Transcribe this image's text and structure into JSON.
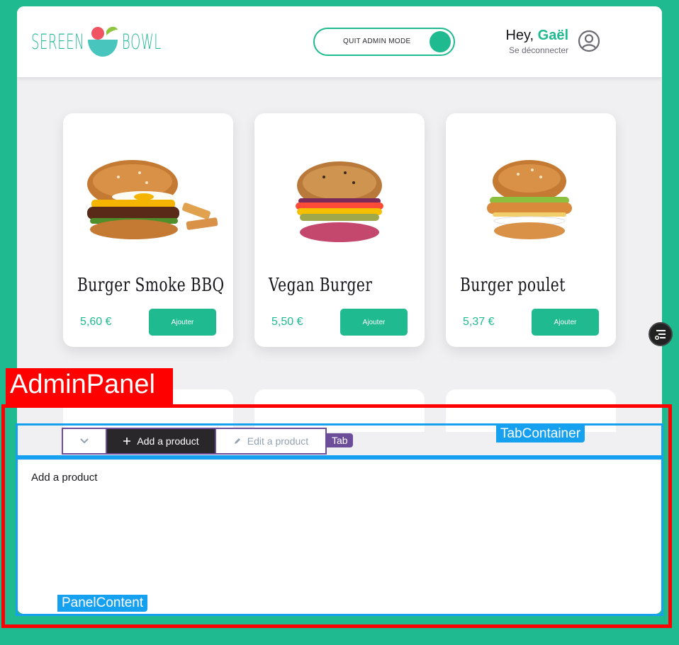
{
  "brand": {
    "logo_left": "SEREEN",
    "logo_right": "BOWL"
  },
  "header": {
    "toggle_label": "QUIT ADMIN MODE",
    "greeting_prefix": "Hey, ",
    "user_name": "Gaël",
    "logout_label": "Se déconnecter"
  },
  "products": [
    {
      "title": "Burger Smoke BBQ",
      "price": "5,60 €",
      "button": "Ajouter",
      "image_icon": "burger-bbq-image"
    },
    {
      "title": "Vegan Burger",
      "price": "5,50 €",
      "button": "Ajouter",
      "image_icon": "vegan-burger-image"
    },
    {
      "title": "Burger poulet",
      "price": "5,37 €",
      "button": "Ajouter",
      "image_icon": "chicken-burger-image"
    }
  ],
  "admin": {
    "tag": "AdminPanel",
    "tab_container_tag": "TabContainer",
    "tab_tag": "Tab",
    "panel_content_tag": "PanelContent",
    "tabs": {
      "add_label": "Add a product",
      "edit_label": "Edit a product"
    },
    "content_text": "Add a product"
  },
  "colors": {
    "accent": "#1fba8f",
    "annotation_red": "#ff0000",
    "annotation_blue": "#16a0f0",
    "annotation_purple": "#6b4d9a"
  }
}
